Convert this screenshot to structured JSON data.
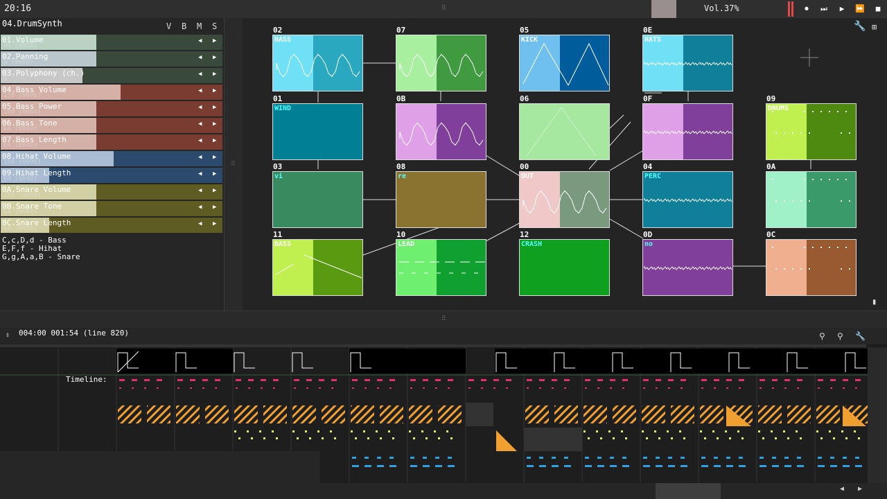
{
  "topbar": {
    "clock": "20:16",
    "volume": "Vol.37%",
    "buttons": [
      "rec-icon",
      "play-from-start-icon",
      "play-icon",
      "next-icon",
      "stop-icon"
    ]
  },
  "instrument": {
    "name": "04.DrumSynth",
    "headers": [
      "V",
      "B",
      "M",
      "S"
    ],
    "params": [
      {
        "label": "01.Volume",
        "value": "80 (0050)",
        "color": "#3a4a3a",
        "fill": "#b9d2c2",
        "pct": 0.43
      },
      {
        "label": "02.Panning",
        "value": "0 (0080)",
        "color": "#3a4a3a",
        "fill": "#b9c7cc",
        "pct": 0.43
      },
      {
        "label": "03.Polyphony (ch.)",
        "value": "4",
        "color": "#3a4a3a",
        "fill": "#c8c8c8",
        "pct": 0.37
      },
      {
        "label": "04.Bass Volume",
        "value": "150 (0096)",
        "color": "#7a3b30",
        "fill": "#d4b0a7",
        "pct": 0.54
      },
      {
        "label": "05.Bass Power",
        "value": "100 (0064)",
        "color": "#7a3b30",
        "fill": "#d4b0a7",
        "pct": 0.43
      },
      {
        "label": "06.Bass Tone",
        "value": "64 (0040)",
        "color": "#7a3b30",
        "fill": "#d4b0a7",
        "pct": 0.43
      },
      {
        "label": "07.Bass Length",
        "value": "64 (0040)",
        "color": "#7a3b30",
        "fill": "#d4b0a7",
        "pct": 0.43
      },
      {
        "label": "08.Hihat Volume",
        "value": "150 (0096)",
        "color": "#2c4a6e",
        "fill": "#a9bcd3",
        "pct": 0.51
      },
      {
        "label": "09.Hihat Length",
        "value": "64 (0040)",
        "color": "#2c4a6e",
        "fill": "#a9bcd3",
        "pct": 0.22
      },
      {
        "label": "0A.Snare Volume",
        "value": "150 (0096)",
        "color": "#5e5c22",
        "fill": "#d1d0a4",
        "pct": 0.43
      },
      {
        "label": "0B.Snare Tone",
        "value": "64 (0040)",
        "color": "#5e5c22",
        "fill": "#d1d0a4",
        "pct": 0.43
      },
      {
        "label": "0C.Snare Length",
        "value": "64 (0040)",
        "color": "#5e5c22",
        "fill": "#d1d0a4",
        "pct": 0.22
      }
    ],
    "notes": [
      "C,c,D,d - Bass",
      "E,F,f - Hihat",
      "G,g,A,a,B - Snare"
    ]
  },
  "modules": [
    {
      "id": "02",
      "name": "BASS",
      "bg": "#2aa8c0",
      "light": "#6fe0f5",
      "wave": "noisy"
    },
    {
      "id": "07",
      "name": "",
      "bg": "#3f9a40",
      "light": "#a8f0a0",
      "wave": "noisy"
    },
    {
      "id": "05",
      "name": "KICK",
      "bg": "#005c9a",
      "light": "#6fc0ef",
      "wave": "triangle"
    },
    {
      "id": "0E",
      "name": "HATS",
      "bg": "#0f7f9a",
      "light": "#6fe0f5",
      "wave": "flat"
    },
    {
      "id": "01",
      "name": "WIND",
      "bg": "#007f95",
      "light": "",
      "wave": "none"
    },
    {
      "id": "0B",
      "name": "",
      "bg": "#7f3f9a",
      "light": "#e0a0e8",
      "wave": "noisy"
    },
    {
      "id": "06",
      "name": "",
      "bg": "#a6e8a0",
      "light": "#a6e8a0",
      "wave": "saw"
    },
    {
      "id": "0F",
      "name": "",
      "bg": "#7f3f9a",
      "light": "#e0a0e8",
      "wave": "flat"
    },
    {
      "id": "09",
      "name": "DRUMS",
      "bg": "#4f8a10",
      "light": "#c0f050",
      "wave": "dots"
    },
    {
      "id": "03",
      "name": "vi",
      "bg": "#3a8a60",
      "light": "",
      "wave": "none"
    },
    {
      "id": "08",
      "name": "re",
      "bg": "#8a7230",
      "light": "",
      "wave": "none"
    },
    {
      "id": "00",
      "name": "OUT",
      "bg": "#7a9a80",
      "light": "#f0c8c8",
      "wave": "noisy"
    },
    {
      "id": "04",
      "name": "PERC",
      "bg": "#0f7f9a",
      "light": "",
      "wave": "flat"
    },
    {
      "id": "0A",
      "name": "",
      "bg": "#3a9a6a",
      "light": "#a0f0c8",
      "wave": "dots"
    },
    {
      "id": "11",
      "name": "BASS",
      "bg": "#5a9a10",
      "light": "#c0f050",
      "wave": "ramp"
    },
    {
      "id": "10",
      "name": "LEAD",
      "bg": "#10a030",
      "light": "#6fef70",
      "wave": "dash"
    },
    {
      "id": "12",
      "name": "CRASH",
      "bg": "#10a020",
      "light": "",
      "wave": "none"
    },
    {
      "id": "0D",
      "name": "no",
      "bg": "#7f3f9a",
      "light": "",
      "wave": "flat"
    },
    {
      "id": "0C",
      "name": "",
      "bg": "#9a5a30",
      "light": "#f0b090",
      "wave": "dots"
    }
  ],
  "pattern": {
    "position": "004:00 001:54 (line 820)",
    "timeline_label": "Timeline:"
  }
}
